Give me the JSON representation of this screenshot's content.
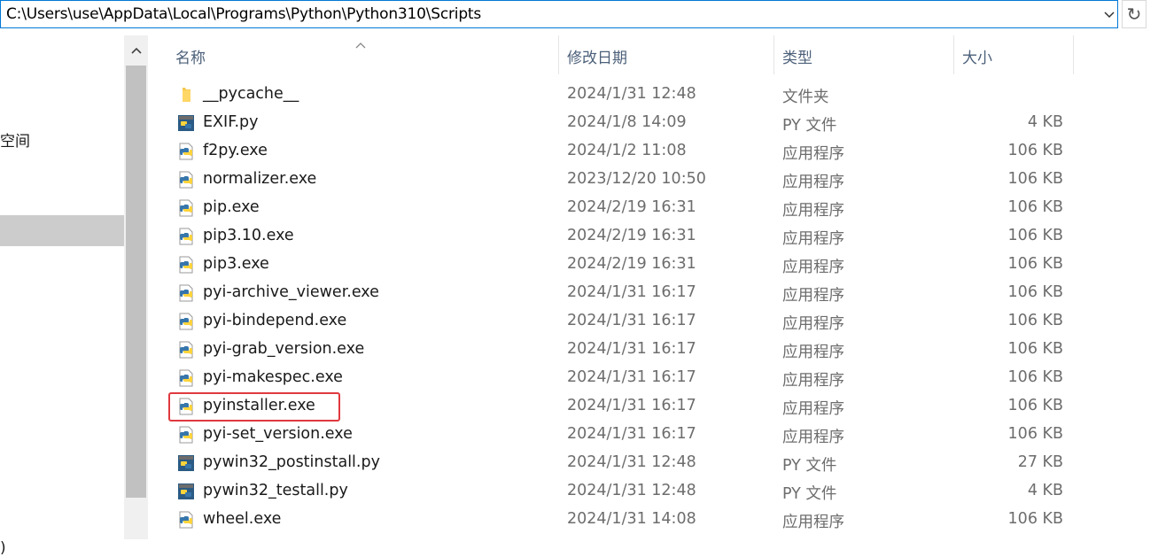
{
  "address_bar": {
    "path": "C:\\Users\\use\\AppData\\Local\\Programs\\Python\\Python310\\Scripts",
    "dropdown_icon": "chevron-down-icon",
    "refresh_icon": "refresh-icon"
  },
  "nav_pane": {
    "item_partial_1": "空间",
    "item_partial_2": ")"
  },
  "columns": {
    "name": "名称",
    "date": "修改日期",
    "type": "类型",
    "size": "大小"
  },
  "files": [
    {
      "name": "__pycache__",
      "date": "2024/1/31 12:48",
      "type": "文件夹",
      "size": "",
      "icon": "folder-icon"
    },
    {
      "name": "EXIF.py",
      "date": "2024/1/8 14:09",
      "type": "PY 文件",
      "size": "4 KB",
      "icon": "python-file-icon"
    },
    {
      "name": "f2py.exe",
      "date": "2024/1/2 11:08",
      "type": "应用程序",
      "size": "106 KB",
      "icon": "python-exe-icon"
    },
    {
      "name": "normalizer.exe",
      "date": "2023/12/20 10:50",
      "type": "应用程序",
      "size": "106 KB",
      "icon": "python-exe-icon"
    },
    {
      "name": "pip.exe",
      "date": "2024/2/19 16:31",
      "type": "应用程序",
      "size": "106 KB",
      "icon": "python-exe-icon"
    },
    {
      "name": "pip3.10.exe",
      "date": "2024/2/19 16:31",
      "type": "应用程序",
      "size": "106 KB",
      "icon": "python-exe-icon"
    },
    {
      "name": "pip3.exe",
      "date": "2024/2/19 16:31",
      "type": "应用程序",
      "size": "106 KB",
      "icon": "python-exe-icon"
    },
    {
      "name": "pyi-archive_viewer.exe",
      "date": "2024/1/31 16:17",
      "type": "应用程序",
      "size": "106 KB",
      "icon": "python-exe-icon"
    },
    {
      "name": "pyi-bindepend.exe",
      "date": "2024/1/31 16:17",
      "type": "应用程序",
      "size": "106 KB",
      "icon": "python-exe-icon"
    },
    {
      "name": "pyi-grab_version.exe",
      "date": "2024/1/31 16:17",
      "type": "应用程序",
      "size": "106 KB",
      "icon": "python-exe-icon"
    },
    {
      "name": "pyi-makespec.exe",
      "date": "2024/1/31 16:17",
      "type": "应用程序",
      "size": "106 KB",
      "icon": "python-exe-icon"
    },
    {
      "name": "pyinstaller.exe",
      "date": "2024/1/31 16:17",
      "type": "应用程序",
      "size": "106 KB",
      "icon": "python-exe-icon"
    },
    {
      "name": "pyi-set_version.exe",
      "date": "2024/1/31 16:17",
      "type": "应用程序",
      "size": "106 KB",
      "icon": "python-exe-icon"
    },
    {
      "name": "pywin32_postinstall.py",
      "date": "2024/1/31 12:48",
      "type": "PY 文件",
      "size": "27 KB",
      "icon": "python-file-icon"
    },
    {
      "name": "pywin32_testall.py",
      "date": "2024/1/31 12:48",
      "type": "PY 文件",
      "size": "4 KB",
      "icon": "python-file-icon"
    },
    {
      "name": "wheel.exe",
      "date": "2024/1/31 14:08",
      "type": "应用程序",
      "size": "106 KB",
      "icon": "python-exe-icon"
    }
  ],
  "highlighted_file": "pyinstaller.exe",
  "colors": {
    "address_border": "#0078d7",
    "highlight_box": "#e0393f",
    "header_text": "#4c607a",
    "nav_selected": "#cccccc"
  }
}
